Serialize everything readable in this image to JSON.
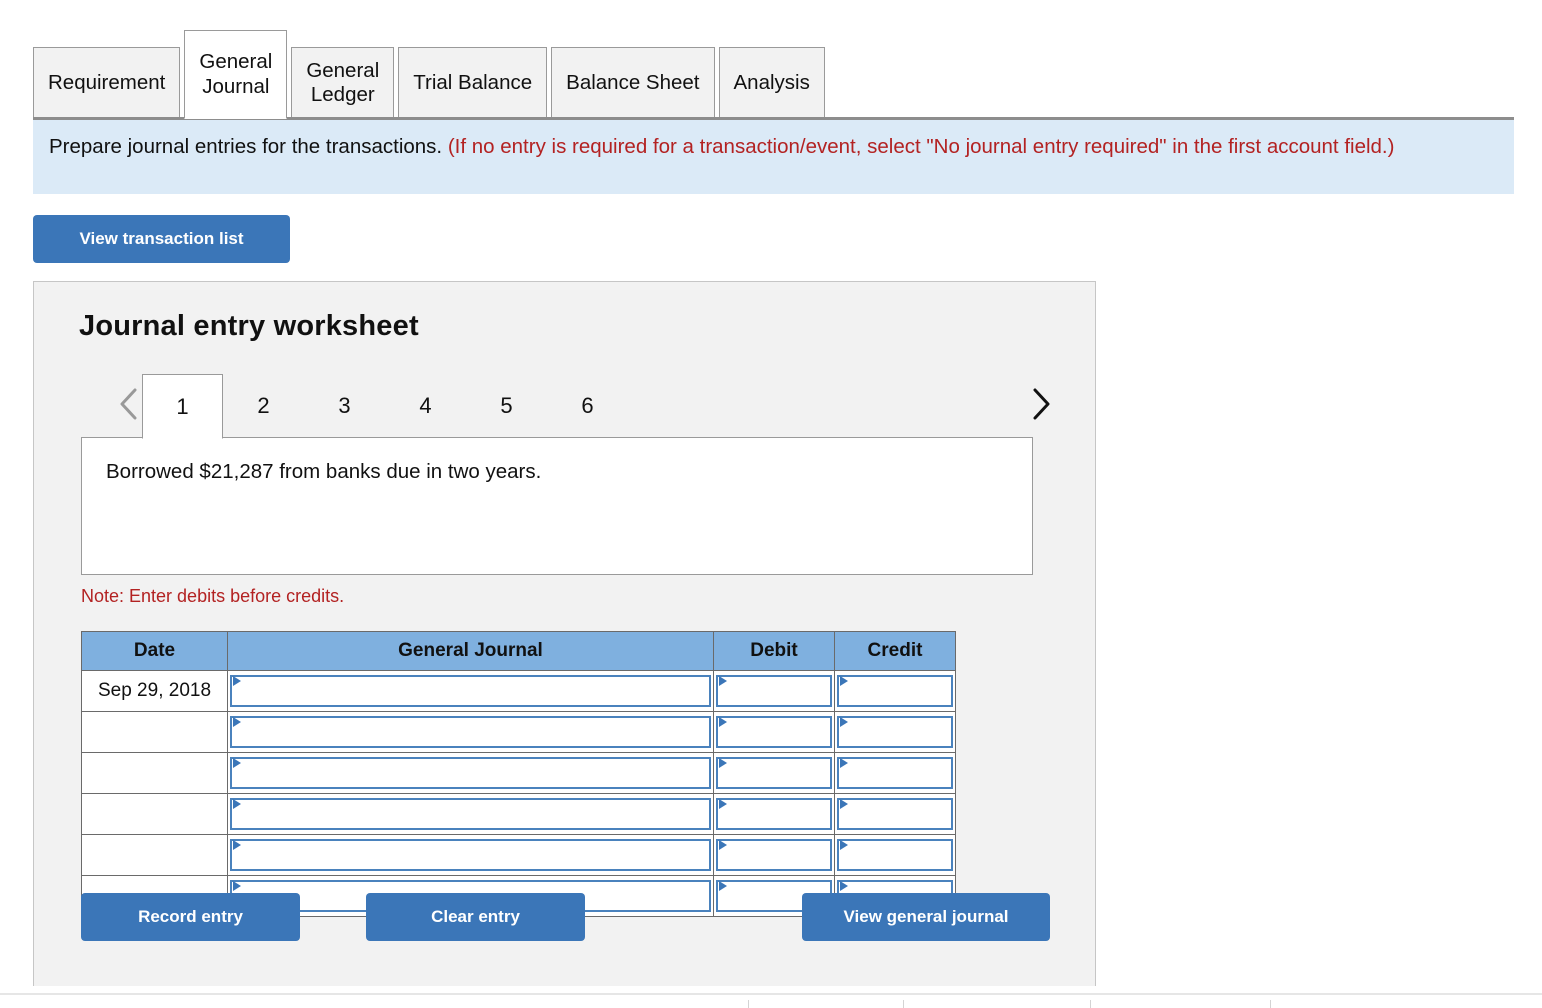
{
  "tabs": {
    "items": [
      {
        "label": "Requirement",
        "active": false
      },
      {
        "label": "General\nJournal",
        "active": true
      },
      {
        "label": "General\nLedger",
        "active": false
      },
      {
        "label": "Trial Balance",
        "active": false
      },
      {
        "label": "Balance Sheet",
        "active": false
      },
      {
        "label": "Analysis",
        "active": false
      }
    ]
  },
  "banner": {
    "main_text": "Prepare journal entries for the transactions. ",
    "hint_text": "(If no entry is required for a transaction/event, select \"No journal entry required\" in the first account field.)"
  },
  "toolbar": {
    "view_transaction_list_label": "View transaction list"
  },
  "worksheet": {
    "title": "Journal entry worksheet",
    "pager": {
      "prev_icon": "chevron-left-icon",
      "next_icon": "chevron-right-icon",
      "pages": [
        "1",
        "2",
        "3",
        "4",
        "5",
        "6"
      ],
      "active_page": "1"
    },
    "description": "Borrowed $21,287 from banks due in two years.",
    "note": "Note: Enter debits before credits.",
    "table": {
      "headers": [
        "Date",
        "General Journal",
        "Debit",
        "Credit"
      ],
      "rows": [
        {
          "date": "Sep 29, 2018",
          "general_journal": "",
          "debit": "",
          "credit": ""
        },
        {
          "date": "",
          "general_journal": "",
          "debit": "",
          "credit": ""
        },
        {
          "date": "",
          "general_journal": "",
          "debit": "",
          "credit": ""
        },
        {
          "date": "",
          "general_journal": "",
          "debit": "",
          "credit": ""
        },
        {
          "date": "",
          "general_journal": "",
          "debit": "",
          "credit": ""
        },
        {
          "date": "",
          "general_journal": "",
          "debit": "",
          "credit": ""
        }
      ]
    },
    "actions": {
      "record_entry_label": "Record entry",
      "clear_entry_label": "Clear entry",
      "view_general_journal_label": "View general journal"
    }
  },
  "colors": {
    "accent_blue": "#3b76b8",
    "header_blue": "#7fb0df",
    "banner_blue": "#dbeaf7",
    "panel_gray": "#f2f2f2",
    "alert_red": "#b32222",
    "input_border_blue": "#4a82bd"
  }
}
